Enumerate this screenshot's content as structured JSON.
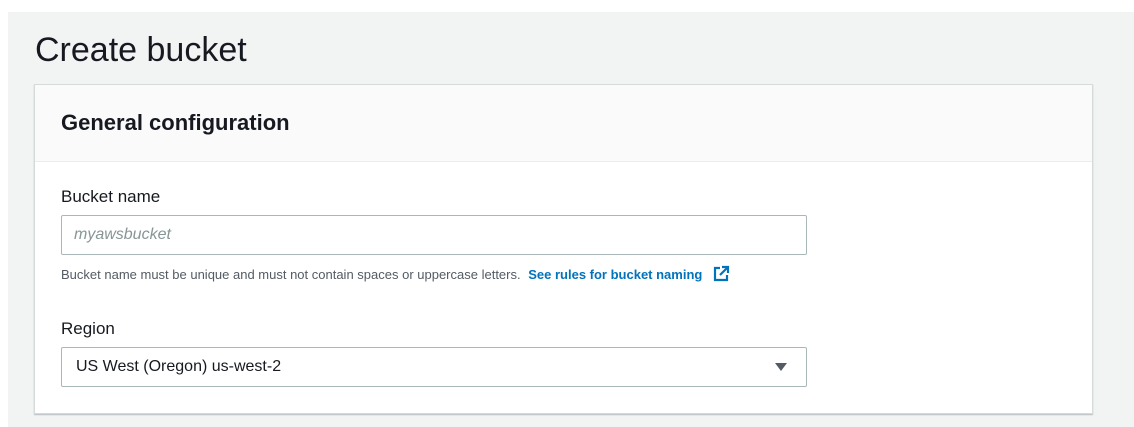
{
  "page": {
    "title": "Create bucket"
  },
  "general_configuration": {
    "title": "General configuration",
    "bucket_name": {
      "label": "Bucket name",
      "value": "",
      "placeholder": "myawsbucket",
      "hint": "Bucket name must be unique and must not contain spaces or uppercase letters.",
      "rules_link": "See rules for bucket naming",
      "rules_link_icon": "external-link-icon"
    },
    "region": {
      "label": "Region",
      "selected": "US West (Oregon) us-west-2",
      "dropdown_icon": "caret-down-icon"
    }
  },
  "colors": {
    "page_background": "#f2f3f3",
    "panel_header": "#fafafa",
    "link": "#0073bb",
    "text": "#16191f",
    "hint_text": "#545b64",
    "placeholder": "#879596",
    "input_border": "#aab7b8"
  }
}
